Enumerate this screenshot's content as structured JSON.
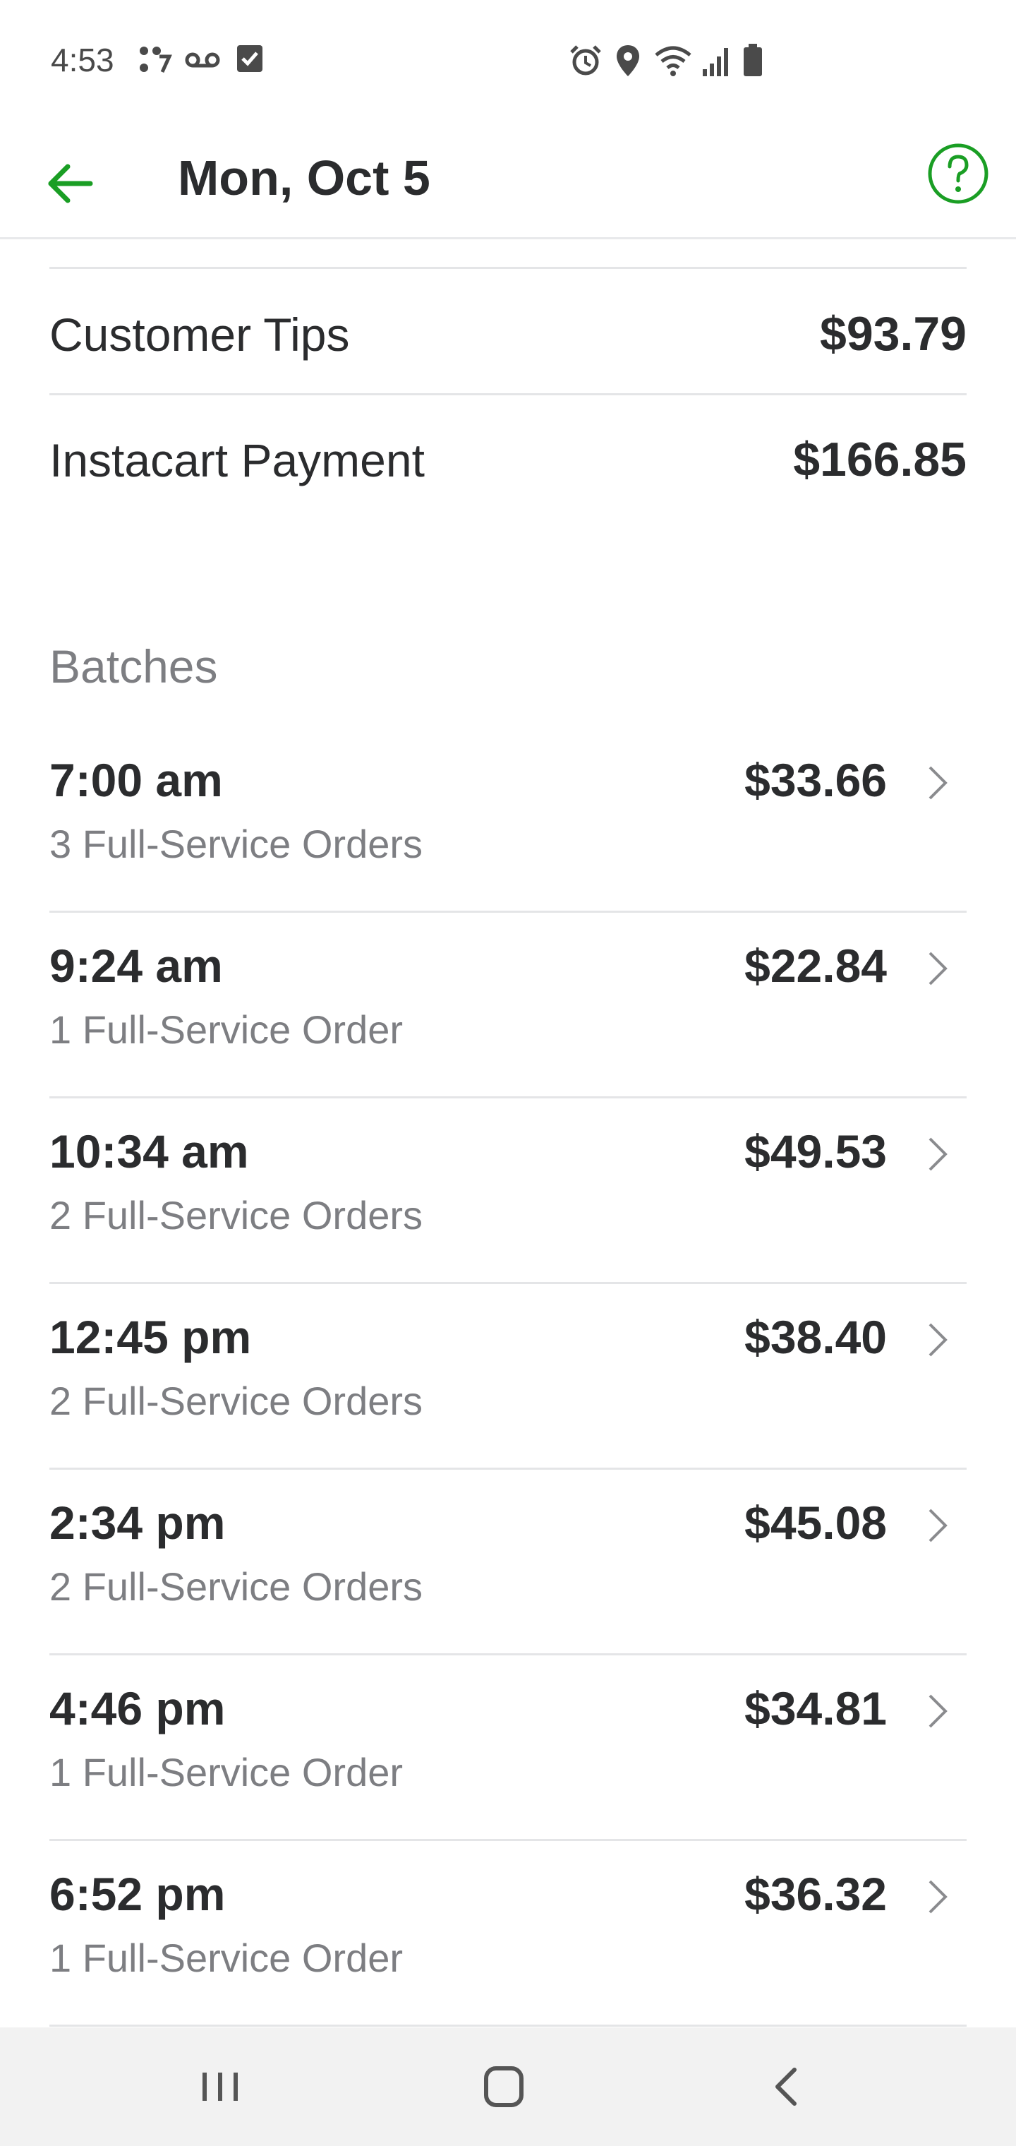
{
  "status_bar": {
    "time": "4:53",
    "left_icons": [
      "dots-status-icon",
      "voicemail-icon",
      "checkbox-icon"
    ],
    "right_icons": [
      "alarm-icon",
      "location-icon",
      "wifi-icon",
      "signal-icon",
      "battery-icon"
    ]
  },
  "app_bar": {
    "title": "Mon, Oct 5",
    "back_icon": "arrow-left-icon",
    "help_icon": "question-circle-icon",
    "accent_color": "#1a9e24"
  },
  "summary": {
    "customer_tips_label": "Customer Tips",
    "customer_tips_value": "$93.79",
    "instacart_payment_label": "Instacart Payment",
    "instacart_payment_value": "$166.85"
  },
  "batches": {
    "section_title": "Batches",
    "items": [
      {
        "time": "7:00 am",
        "orders": "3 Full-Service Orders",
        "amount": "$33.66"
      },
      {
        "time": "9:24 am",
        "orders": "1 Full-Service Order",
        "amount": "$22.84"
      },
      {
        "time": "10:34 am",
        "orders": "2 Full-Service Orders",
        "amount": "$49.53"
      },
      {
        "time": "12:45 pm",
        "orders": "2 Full-Service Orders",
        "amount": "$38.40"
      },
      {
        "time": "2:34 pm",
        "orders": "2 Full-Service Orders",
        "amount": "$45.08"
      },
      {
        "time": "4:46 pm",
        "orders": "1 Full-Service Order",
        "amount": "$34.81"
      },
      {
        "time": "6:52 pm",
        "orders": "1 Full-Service Order",
        "amount": "$36.32"
      }
    ]
  },
  "nav_bar": {
    "icons": [
      "recent-apps-icon",
      "home-icon",
      "back-icon"
    ]
  }
}
